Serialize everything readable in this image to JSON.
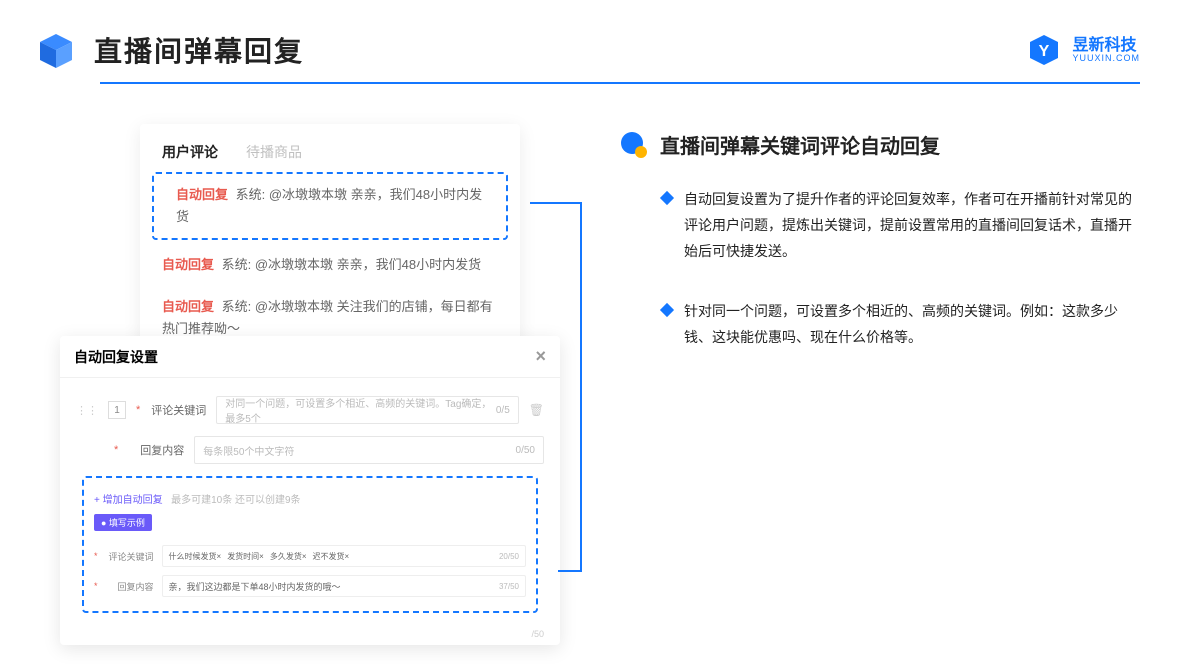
{
  "page": {
    "title": "直播间弹幕回复"
  },
  "brand": {
    "cn": "昱新科技",
    "en": "YUUXIN.COM"
  },
  "tabs": {
    "active": "用户评论",
    "inactive": "待播商品"
  },
  "comments": [
    {
      "tag": "自动回复",
      "text": "系统: @冰墩墩本墩 亲亲，我们48小时内发货"
    },
    {
      "tag": "自动回复",
      "text": "系统: @冰墩墩本墩 亲亲，我们48小时内发货"
    },
    {
      "tag": "自动回复",
      "text": "系统: @冰墩墩本墩 关注我们的店铺，每日都有热门推荐呦～"
    }
  ],
  "settings": {
    "title": "自动回复设置",
    "row_num": "1",
    "keyword_label": "评论关键词",
    "keyword_placeholder": "对同一个问题，可设置多个相近、高频的关键词。Tag确定，最多5个",
    "keyword_count": "0/5",
    "content_label": "回复内容",
    "content_placeholder": "每条限50个中文字符",
    "content_count": "0/50",
    "add_link": "+ 增加自动回复",
    "add_hint": "最多可建10条 还可以创建9条",
    "example_badge": "● 填写示例",
    "ex_keyword_label": "评论关键词",
    "ex_tags": [
      "什么时候发货×",
      "发货时间×",
      "多久发货×",
      "迟不发货×"
    ],
    "ex_keyword_count": "20/50",
    "ex_content_label": "回复内容",
    "ex_content_value": "亲，我们这边都是下单48小时内发货的哦～",
    "ex_content_count": "37/50",
    "bottom_count": "/50"
  },
  "section": {
    "title": "直播间弹幕关键词评论自动回复",
    "bullets": [
      "自动回复设置为了提升作者的评论回复效率，作者可在开播前针对常见的评论用户问题，提炼出关键词，提前设置常用的直播间回复话术，直播开始后可快捷发送。",
      "针对同一个问题，可设置多个相近的、高频的关键词。例如：这款多少钱、这块能优惠吗、现在什么价格等。"
    ]
  }
}
